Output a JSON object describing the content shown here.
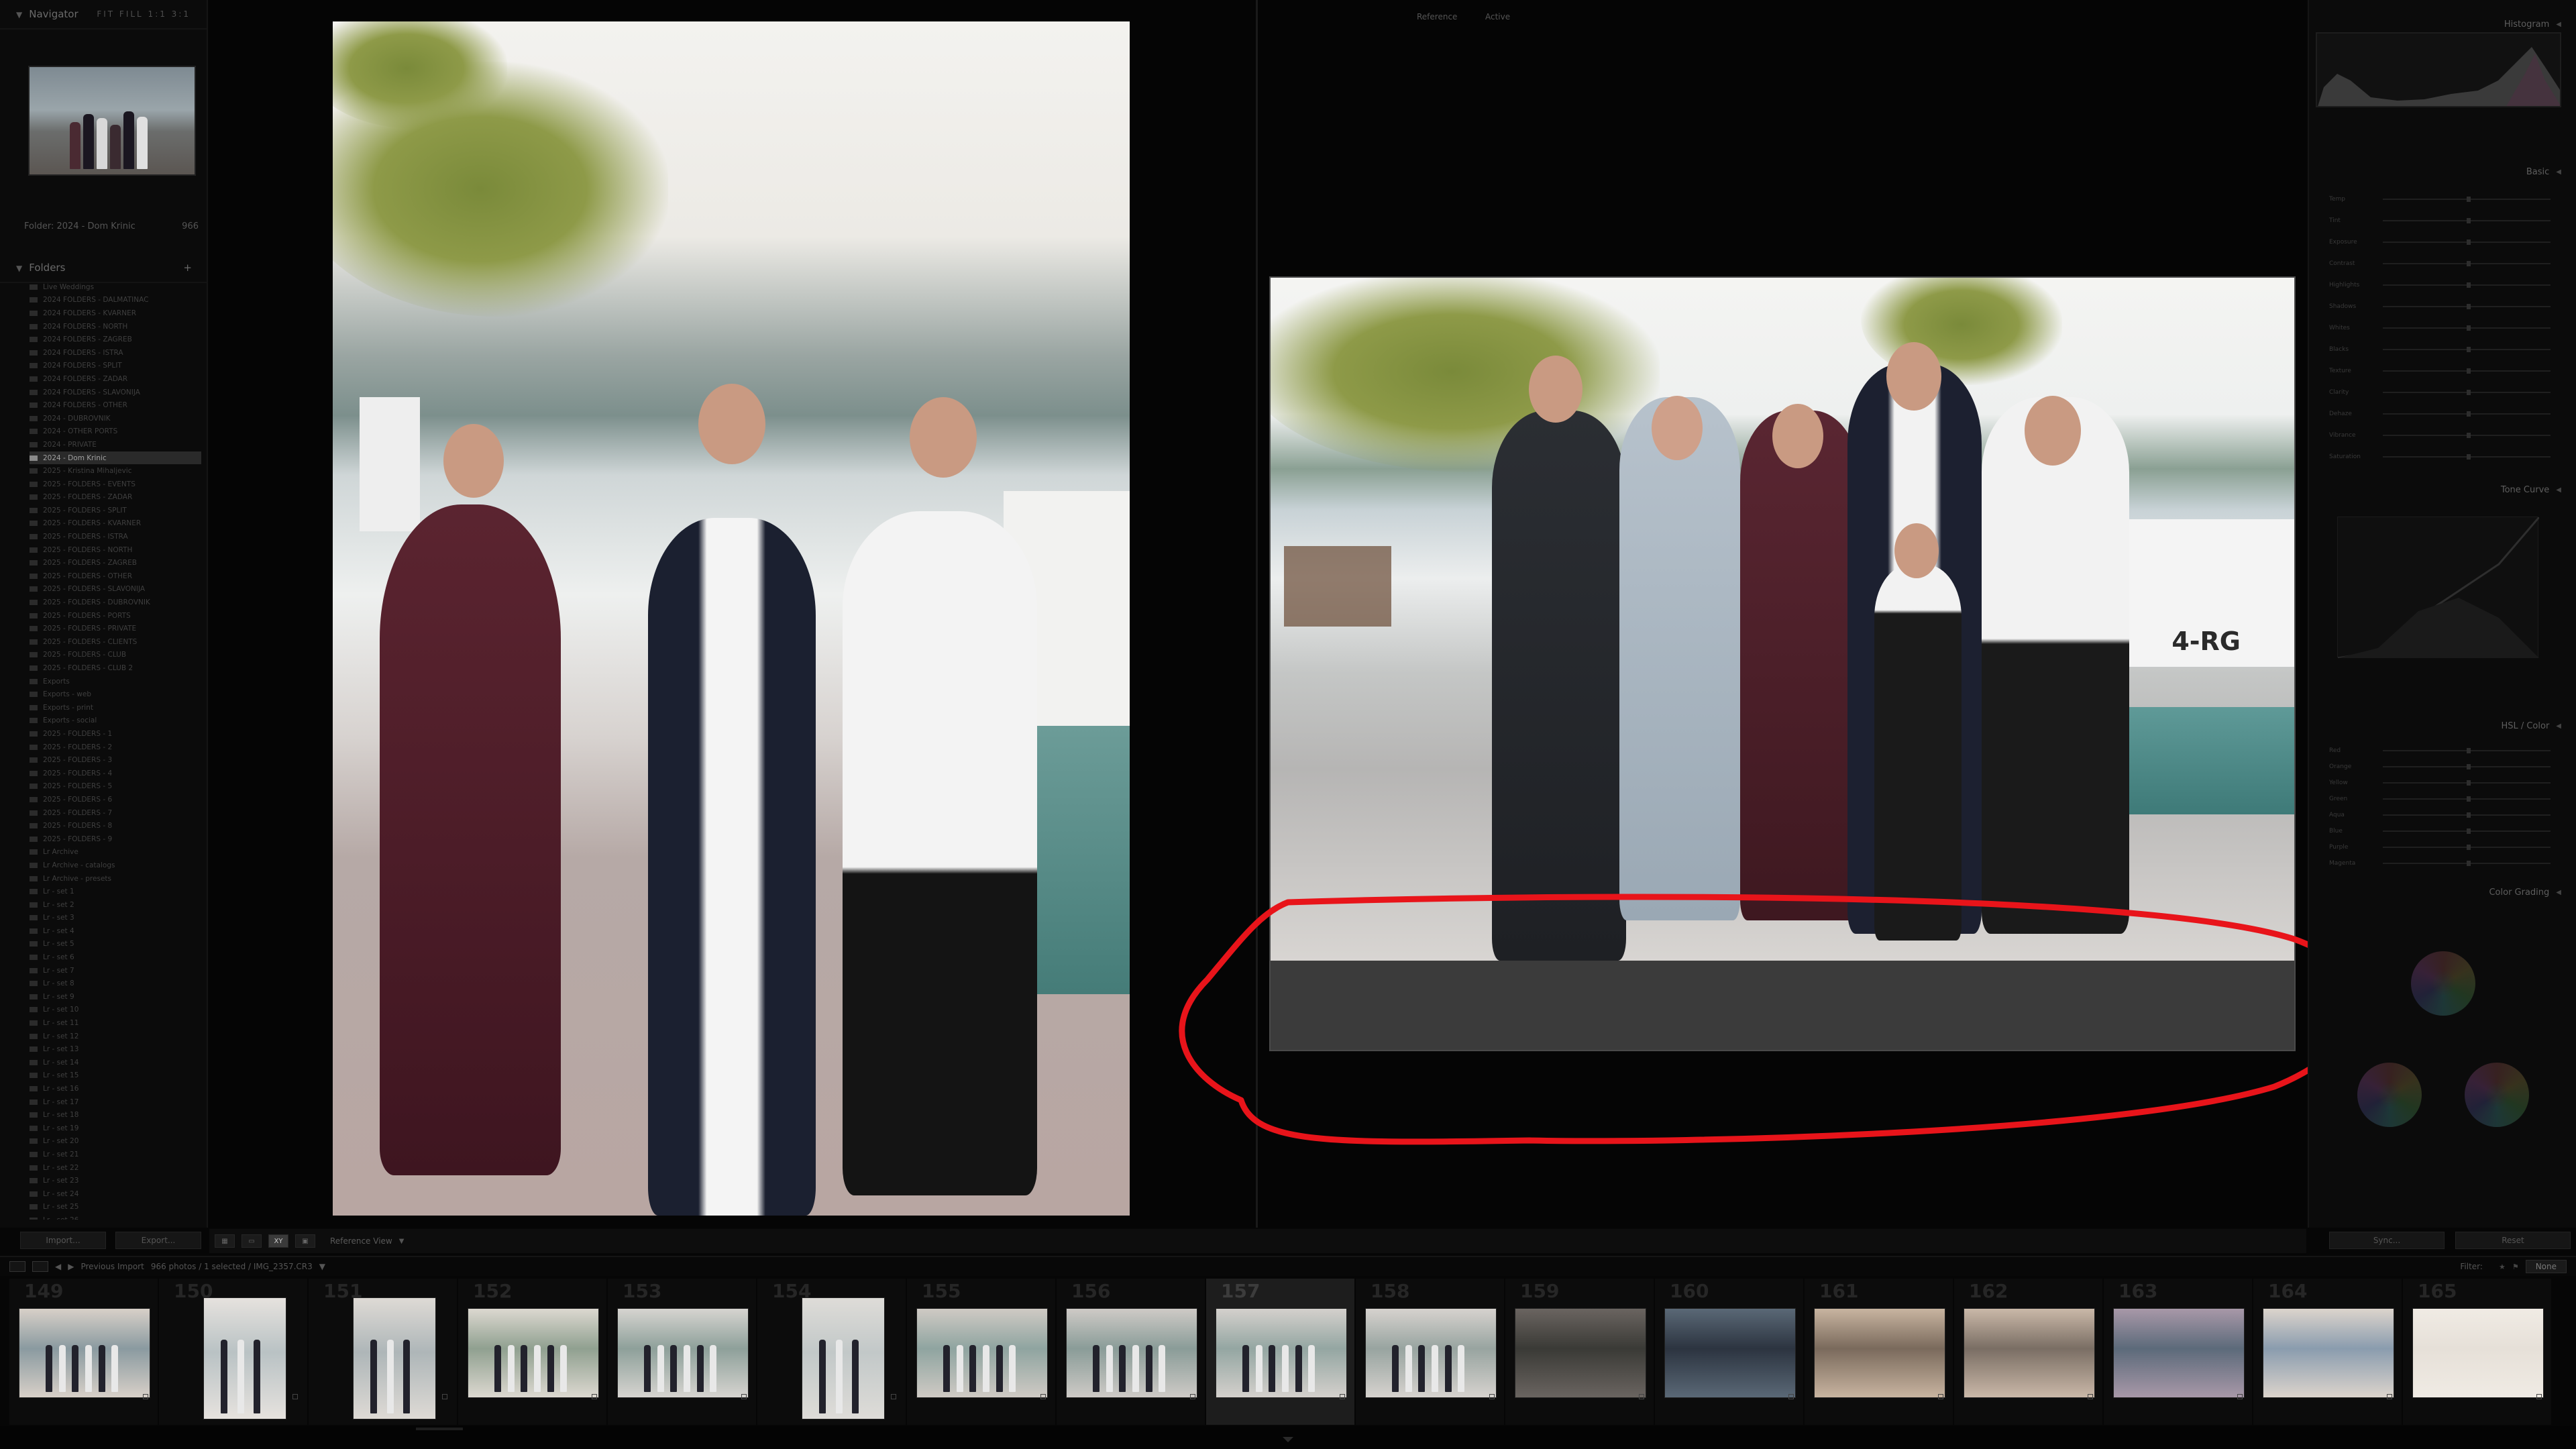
{
  "left_panel": {
    "navigator_title": "Navigator",
    "navigator_zoom": "FIT FILL 1:1 3:1",
    "collection_label": "Folder: 2024 - Dom Krinic",
    "collection_count": "966",
    "folders_title": "Folders",
    "folders": [
      "Live Weddings",
      "2024 FOLDERS - DALMATINAC",
      "2024 FOLDERS - KVARNER",
      "2024 FOLDERS - NORTH",
      "2024 FOLDERS - ZAGREB",
      "2024 FOLDERS - ISTRA",
      "2024 FOLDERS - SPLIT",
      "2024 FOLDERS - ZADAR",
      "2024 FOLDERS - SLAVONIJA",
      "2024 FOLDERS - OTHER",
      "2024 - DUBROVNIK",
      "2024 - OTHER PORTS",
      "2024 - PRIVATE",
      "2024 - Dom Krinic",
      "2025 - Kristina Mihaljevic",
      "2025 - FOLDERS - EVENTS",
      "2025 - FOLDERS - ZADAR",
      "2025 - FOLDERS - SPLIT",
      "2025 - FOLDERS - KVARNER",
      "2025 - FOLDERS - ISTRA",
      "2025 - FOLDERS - NORTH",
      "2025 - FOLDERS - ZAGREB",
      "2025 - FOLDERS - OTHER",
      "2025 - FOLDERS - SLAVONIJA",
      "2025 - FOLDERS - DUBROVNIK",
      "2025 - FOLDERS - PORTS",
      "2025 - FOLDERS - PRIVATE",
      "2025 - FOLDERS - CLIENTS",
      "2025 - FOLDERS - CLUB",
      "2025 - FOLDERS - CLUB 2",
      "Exports",
      "Exports - web",
      "Exports - print",
      "Exports - social",
      "2025 - FOLDERS - 1",
      "2025 - FOLDERS - 2",
      "2025 - FOLDERS - 3",
      "2025 - FOLDERS - 4",
      "2025 - FOLDERS - 5",
      "2025 - FOLDERS - 6",
      "2025 - FOLDERS - 7",
      "2025 - FOLDERS - 8",
      "2025 - FOLDERS - 9",
      "Lr Archive",
      "Lr Archive - catalogs",
      "Lr Archive - presets",
      "Lr - set 1",
      "Lr - set 2",
      "Lr - set 3",
      "Lr - set 4",
      "Lr - set 5",
      "Lr - set 6",
      "Lr - set 7",
      "Lr - set 8",
      "Lr - set 9",
      "Lr - set 10",
      "Lr - set 11",
      "Lr - set 12",
      "Lr - set 13",
      "Lr - set 14",
      "Lr - set 15",
      "Lr - set 16",
      "Lr - set 17",
      "Lr - set 18",
      "Lr - set 19",
      "Lr - set 20",
      "Lr - set 21",
      "Lr - set 22",
      "Lr - set 23",
      "Lr - set 24",
      "Lr - set 25",
      "Lr - set 26"
    ],
    "active_folder_index": 13,
    "import_button": "Import...",
    "export_button": "Export..."
  },
  "center": {
    "reference_label": "Reference",
    "active_label": "Active",
    "boat_text": "4-RG"
  },
  "toolbar": {
    "reference_view_label": "Reference View",
    "grid_btn": "▦",
    "loupe_btn": "▭",
    "compare_btn": "XY",
    "survey_btn": "▣"
  },
  "right_panel": {
    "histogram_title": "Histogram",
    "basic_title": "Basic",
    "tone_curve_title": "Tone Curve",
    "hsl_title": "HSL / Color",
    "color_grading_title": "Color Grading",
    "basic_sliders": [
      "Temp",
      "Tint",
      "Exposure",
      "Contrast",
      "Highlights",
      "Shadows",
      "Whites",
      "Blacks",
      "Texture",
      "Clarity",
      "Dehaze",
      "Vibrance",
      "Saturation"
    ],
    "hsl_sliders": [
      "Red",
      "Orange",
      "Yellow",
      "Green",
      "Aqua",
      "Blue",
      "Purple",
      "Magenta"
    ],
    "sync_button": "Sync...",
    "reset_button": "Reset"
  },
  "filmstrip_header": {
    "source_label": "Previous Import",
    "count_label": "966 photos / 1 selected / IMG_2357.CR3",
    "filter_label": "Filter:",
    "filter_value": "None"
  },
  "filmstrip": {
    "selected_index": 8,
    "cells": [
      {
        "num": "149",
        "orient": "land"
      },
      {
        "num": "150",
        "orient": "port"
      },
      {
        "num": "151",
        "orient": "port"
      },
      {
        "num": "152",
        "orient": "land"
      },
      {
        "num": "153",
        "orient": "land"
      },
      {
        "num": "154",
        "orient": "port"
      },
      {
        "num": "155",
        "orient": "land"
      },
      {
        "num": "156",
        "orient": "land"
      },
      {
        "num": "157",
        "orient": "land"
      },
      {
        "num": "158",
        "orient": "land"
      },
      {
        "num": "159",
        "orient": "land"
      },
      {
        "num": "160",
        "orient": "land"
      },
      {
        "num": "161",
        "orient": "land"
      },
      {
        "num": "162",
        "orient": "land"
      },
      {
        "num": "163",
        "orient": "land"
      },
      {
        "num": "164",
        "orient": "land"
      },
      {
        "num": "165",
        "orient": "land"
      }
    ]
  },
  "colors": {
    "annotation": "#e8141a",
    "panel_bg": "#0b0b0b",
    "selection": "#2a2a2a"
  }
}
